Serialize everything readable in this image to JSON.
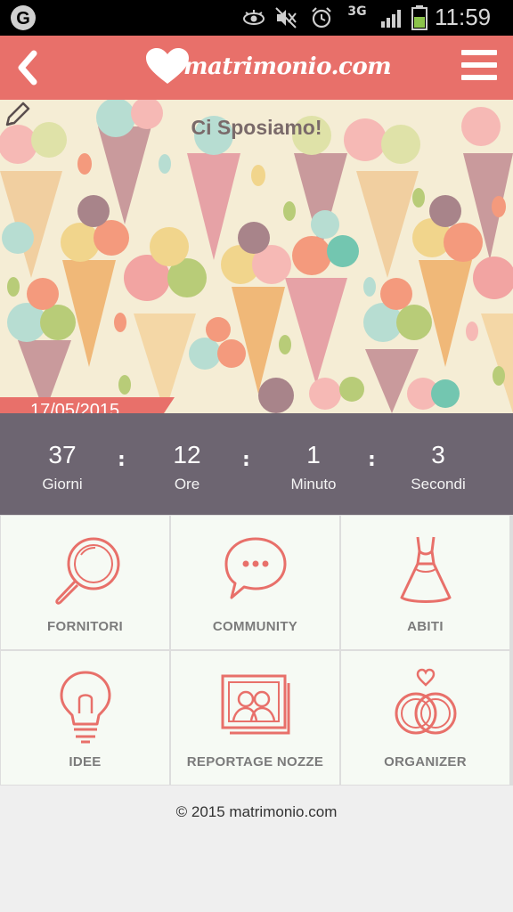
{
  "status_bar": {
    "network": "3G",
    "time": "11:59",
    "icons": [
      "google-icon",
      "eye-icon",
      "mute-icon",
      "alarm-icon",
      "signal-icon",
      "battery-icon"
    ]
  },
  "app_bar": {
    "brand": "matrimonio.com",
    "accent_color": "#e8706a"
  },
  "hero": {
    "title": "Ci Sposiamo!",
    "date": "17/05/2015"
  },
  "countdown": {
    "items": [
      {
        "value": "37",
        "label": "Giorni"
      },
      {
        "value": "12",
        "label": "Ore"
      },
      {
        "value": "1",
        "label": "Minuto"
      },
      {
        "value": "3",
        "label": "Secondi"
      }
    ],
    "separator": ":"
  },
  "tiles": [
    {
      "label": "FORNITORI",
      "icon": "magnifier-icon"
    },
    {
      "label": "COMMUNITY",
      "icon": "chat-bubble-icon"
    },
    {
      "label": "ABITI",
      "icon": "dress-icon"
    },
    {
      "label": "IDEE",
      "icon": "lightbulb-icon"
    },
    {
      "label": "REPORTAGE NOZZE",
      "icon": "photo-album-icon"
    },
    {
      "label": "ORGANIZER",
      "icon": "rings-icon"
    }
  ],
  "footer": {
    "copyright": "© 2015 matrimonio.com"
  }
}
